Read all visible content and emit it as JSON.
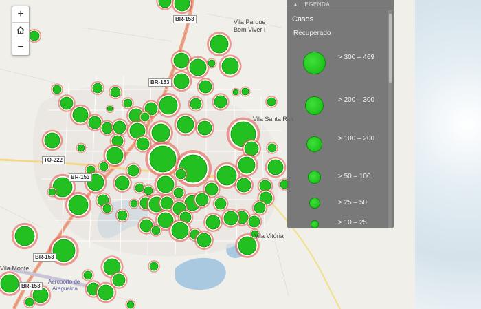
{
  "map": {
    "road_labels": [
      "BR-153",
      "BR-153",
      "BR-153",
      "TO-222",
      "BR-153",
      "BR-153"
    ],
    "place_labels": [
      "Vila Parque",
      "Bom Viver I",
      "Vila Santa Rita",
      "Vila Monte",
      "Aeroporto de",
      "Araguaína",
      "Vila Vitória"
    ],
    "marker_color": "#22c020",
    "marker_ring_color": "#e2524a"
  },
  "zoom": {
    "in_label": "+",
    "out_label": "−",
    "home_icon": "home-icon"
  },
  "legend": {
    "header": "LEGENDA",
    "title": "Casos",
    "subtitle": "Recuperado",
    "items": [
      {
        "label": "> 300 – 469"
      },
      {
        "label": "> 200 – 300"
      },
      {
        "label": "> 100 – 200"
      },
      {
        "label": "> 50 – 100"
      },
      {
        "label": "> 25 – 50"
      },
      {
        "label": "> 10 – 25"
      }
    ]
  }
}
